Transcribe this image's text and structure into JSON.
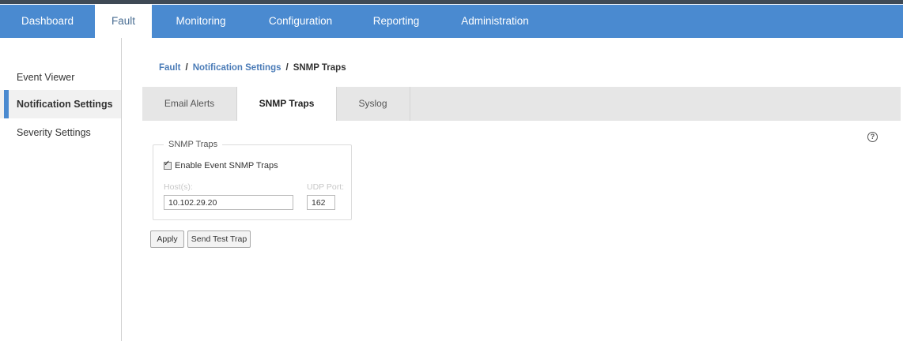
{
  "nav": {
    "items": [
      {
        "label": "Dashboard",
        "active": false
      },
      {
        "label": "Fault",
        "active": true
      },
      {
        "label": "Monitoring",
        "active": false
      },
      {
        "label": "Configuration",
        "active": false
      },
      {
        "label": "Reporting",
        "active": false
      },
      {
        "label": "Administration",
        "active": false
      }
    ]
  },
  "sidebar": {
    "items": [
      {
        "label": "Event Viewer",
        "active": false
      },
      {
        "label": "Notification Settings",
        "active": true
      },
      {
        "label": "Severity Settings",
        "active": false
      }
    ]
  },
  "breadcrumb": {
    "items": [
      "Fault",
      "Notification Settings",
      "SNMP Traps"
    ],
    "separator": "/"
  },
  "tabs": [
    {
      "label": "Email Alerts",
      "active": false
    },
    {
      "label": "SNMP Traps",
      "active": true
    },
    {
      "label": "Syslog",
      "active": false
    }
  ],
  "help": {
    "icon": "help-circle-icon",
    "glyph": "?"
  },
  "snmp": {
    "legend": "SNMP Traps",
    "enable_label": "Enable Event SNMP Traps",
    "enable_checked": true,
    "hosts_label": "Host(s):",
    "hosts_value": "10.102.29.20",
    "port_label": "UDP Port:",
    "port_value": "162"
  },
  "actions": {
    "apply_label": "Apply",
    "send_test_label": "Send Test Trap"
  },
  "colors": {
    "nav_bg": "#4a8ad0",
    "link": "#4a7bb7",
    "active_marker": "#4a8ad0"
  }
}
